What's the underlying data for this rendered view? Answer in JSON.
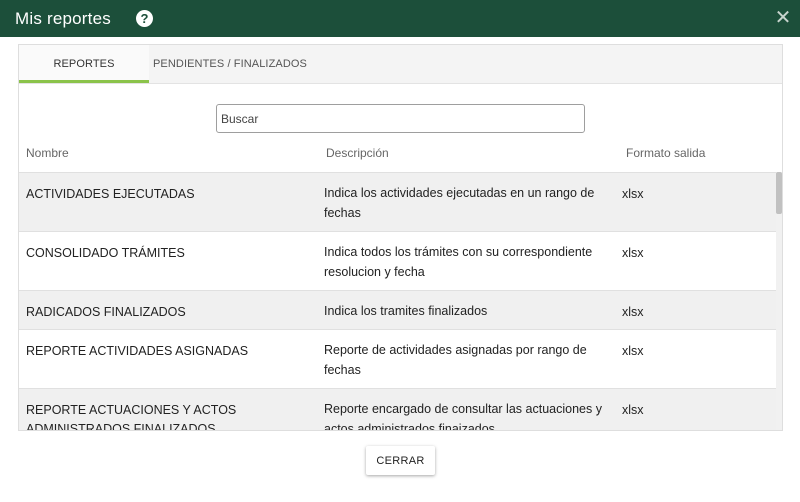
{
  "dialog": {
    "title": "Mis reportes",
    "help_glyph": "?",
    "close_glyph": "✕"
  },
  "tabs": [
    {
      "label": "REPORTES",
      "active": true
    },
    {
      "label": "PENDIENTES / FINALIZADOS",
      "active": false
    }
  ],
  "search": {
    "placeholder": "Buscar",
    "value": ""
  },
  "table": {
    "headers": {
      "name": "Nombre",
      "description": "Descripción",
      "format": "Formato salida"
    },
    "rows": [
      {
        "name": "ACTIVIDADES EJECUTADAS",
        "description": "Indica los actividades ejecutadas en un rango de fechas",
        "format": "xlsx"
      },
      {
        "name": "CONSOLIDADO TRÁMITES",
        "description": "Indica todos los trámites con su correspondiente resolucion y fecha",
        "format": "xlsx"
      },
      {
        "name": "RADICADOS FINALIZADOS",
        "description": "Indica los tramites finalizados",
        "format": "xlsx"
      },
      {
        "name": "REPORTE ACTIVIDADES ASIGNADAS",
        "description": "Reporte de actividades asignadas por rango de fechas",
        "format": "xlsx"
      },
      {
        "name": "REPORTE ACTUACIONES Y ACTOS ADMINISTRADOS FINALIZADOS",
        "description": "Reporte encargado de consultar las actuaciones y actos administrados finaizados",
        "format": "xlsx"
      }
    ]
  },
  "footer": {
    "close_label": "CERRAR"
  },
  "colors": {
    "titlebar": "#1c4f3a",
    "tab_indicator": "#8bc34a"
  }
}
